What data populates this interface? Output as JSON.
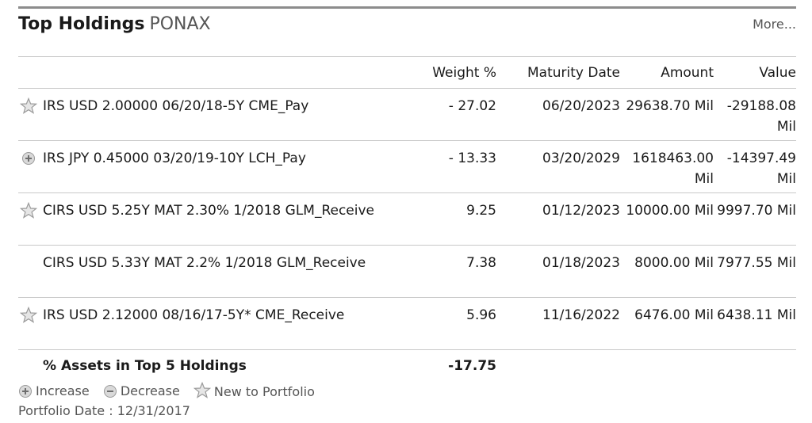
{
  "header": {
    "title": "Top Holdings",
    "ticker": "PONAX",
    "more_label": "More..."
  },
  "columns": {
    "weight": "Weight %",
    "maturity": "Maturity Date",
    "amount": "Amount",
    "value": "Value"
  },
  "holdings": [
    {
      "icon": "star-icon",
      "name": "IRS USD 2.00000 06/20/18-5Y CME_Pay",
      "weight": "- 27.02",
      "maturity": "06/20/2023",
      "amount": "29638.70 Mil",
      "value": "-29188.08 Mil"
    },
    {
      "icon": "plus-circle-icon",
      "name": "IRS JPY 0.45000 03/20/19-10Y LCH_Pay",
      "weight": "- 13.33",
      "maturity": "03/20/2029",
      "amount": "1618463.00 Mil",
      "value": "-14397.49 Mil"
    },
    {
      "icon": "star-icon",
      "name": "CIRS USD 5.25Y MAT 2.30% 1/2018 GLM_Receive",
      "weight": "9.25",
      "maturity": "01/12/2023",
      "amount": "10000.00 Mil",
      "value": "9997.70 Mil"
    },
    {
      "icon": "",
      "name": "CIRS USD 5.33Y MAT 2.2% 1/2018 GLM_Receive",
      "weight": "7.38",
      "maturity": "01/18/2023",
      "amount": "8000.00 Mil",
      "value": "7977.55 Mil"
    },
    {
      "icon": "star-icon",
      "name": "IRS USD 2.12000 08/16/17-5Y* CME_Receive",
      "weight": "5.96",
      "maturity": "11/16/2022",
      "amount": "6476.00 Mil",
      "value": "6438.11 Mil"
    }
  ],
  "total": {
    "label": "% Assets in Top 5 Holdings",
    "weight": "-17.75"
  },
  "legend": {
    "increase": "Increase",
    "decrease": "Decrease",
    "new": "New to Portfolio"
  },
  "portfolio_date": "Portfolio Date : 12/31/2017",
  "colors": {
    "icon_gray": "#9a9a9a",
    "rule": "#8c8c8c",
    "border": "#c8c8c8"
  }
}
